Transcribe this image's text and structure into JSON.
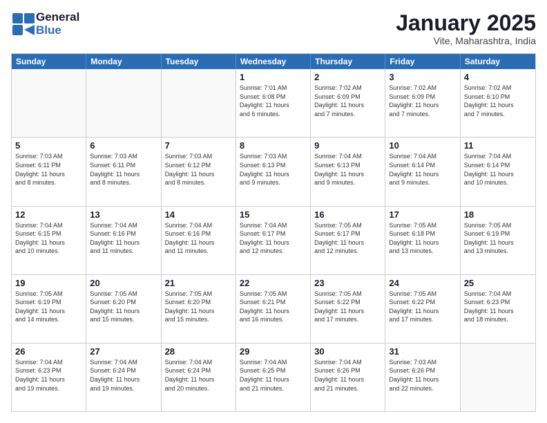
{
  "logo": {
    "line1": "General",
    "line2": "Blue"
  },
  "title": "January 2025",
  "subtitle": "Vite, Maharashtra, India",
  "dayHeaders": [
    "Sunday",
    "Monday",
    "Tuesday",
    "Wednesday",
    "Thursday",
    "Friday",
    "Saturday"
  ],
  "weeks": [
    [
      {
        "num": "",
        "info": ""
      },
      {
        "num": "",
        "info": ""
      },
      {
        "num": "",
        "info": ""
      },
      {
        "num": "1",
        "info": "Sunrise: 7:01 AM\nSunset: 6:08 PM\nDaylight: 11 hours\nand 6 minutes."
      },
      {
        "num": "2",
        "info": "Sunrise: 7:02 AM\nSunset: 6:09 PM\nDaylight: 11 hours\nand 7 minutes."
      },
      {
        "num": "3",
        "info": "Sunrise: 7:02 AM\nSunset: 6:09 PM\nDaylight: 11 hours\nand 7 minutes."
      },
      {
        "num": "4",
        "info": "Sunrise: 7:02 AM\nSunset: 6:10 PM\nDaylight: 11 hours\nand 7 minutes."
      }
    ],
    [
      {
        "num": "5",
        "info": "Sunrise: 7:03 AM\nSunset: 6:11 PM\nDaylight: 11 hours\nand 8 minutes."
      },
      {
        "num": "6",
        "info": "Sunrise: 7:03 AM\nSunset: 6:11 PM\nDaylight: 11 hours\nand 8 minutes."
      },
      {
        "num": "7",
        "info": "Sunrise: 7:03 AM\nSunset: 6:12 PM\nDaylight: 11 hours\nand 8 minutes."
      },
      {
        "num": "8",
        "info": "Sunrise: 7:03 AM\nSunset: 6:13 PM\nDaylight: 11 hours\nand 9 minutes."
      },
      {
        "num": "9",
        "info": "Sunrise: 7:04 AM\nSunset: 6:13 PM\nDaylight: 11 hours\nand 9 minutes."
      },
      {
        "num": "10",
        "info": "Sunrise: 7:04 AM\nSunset: 6:14 PM\nDaylight: 11 hours\nand 9 minutes."
      },
      {
        "num": "11",
        "info": "Sunrise: 7:04 AM\nSunset: 6:14 PM\nDaylight: 11 hours\nand 10 minutes."
      }
    ],
    [
      {
        "num": "12",
        "info": "Sunrise: 7:04 AM\nSunset: 6:15 PM\nDaylight: 11 hours\nand 10 minutes."
      },
      {
        "num": "13",
        "info": "Sunrise: 7:04 AM\nSunset: 6:16 PM\nDaylight: 11 hours\nand 11 minutes."
      },
      {
        "num": "14",
        "info": "Sunrise: 7:04 AM\nSunset: 6:16 PM\nDaylight: 11 hours\nand 11 minutes."
      },
      {
        "num": "15",
        "info": "Sunrise: 7:04 AM\nSunset: 6:17 PM\nDaylight: 11 hours\nand 12 minutes."
      },
      {
        "num": "16",
        "info": "Sunrise: 7:05 AM\nSunset: 6:17 PM\nDaylight: 11 hours\nand 12 minutes."
      },
      {
        "num": "17",
        "info": "Sunrise: 7:05 AM\nSunset: 6:18 PM\nDaylight: 11 hours\nand 13 minutes."
      },
      {
        "num": "18",
        "info": "Sunrise: 7:05 AM\nSunset: 6:19 PM\nDaylight: 11 hours\nand 13 minutes."
      }
    ],
    [
      {
        "num": "19",
        "info": "Sunrise: 7:05 AM\nSunset: 6:19 PM\nDaylight: 11 hours\nand 14 minutes."
      },
      {
        "num": "20",
        "info": "Sunrise: 7:05 AM\nSunset: 6:20 PM\nDaylight: 11 hours\nand 15 minutes."
      },
      {
        "num": "21",
        "info": "Sunrise: 7:05 AM\nSunset: 6:20 PM\nDaylight: 11 hours\nand 15 minutes."
      },
      {
        "num": "22",
        "info": "Sunrise: 7:05 AM\nSunset: 6:21 PM\nDaylight: 11 hours\nand 16 minutes."
      },
      {
        "num": "23",
        "info": "Sunrise: 7:05 AM\nSunset: 6:22 PM\nDaylight: 11 hours\nand 17 minutes."
      },
      {
        "num": "24",
        "info": "Sunrise: 7:05 AM\nSunset: 6:22 PM\nDaylight: 11 hours\nand 17 minutes."
      },
      {
        "num": "25",
        "info": "Sunrise: 7:04 AM\nSunset: 6:23 PM\nDaylight: 11 hours\nand 18 minutes."
      }
    ],
    [
      {
        "num": "26",
        "info": "Sunrise: 7:04 AM\nSunset: 6:23 PM\nDaylight: 11 hours\nand 19 minutes."
      },
      {
        "num": "27",
        "info": "Sunrise: 7:04 AM\nSunset: 6:24 PM\nDaylight: 11 hours\nand 19 minutes."
      },
      {
        "num": "28",
        "info": "Sunrise: 7:04 AM\nSunset: 6:24 PM\nDaylight: 11 hours\nand 20 minutes."
      },
      {
        "num": "29",
        "info": "Sunrise: 7:04 AM\nSunset: 6:25 PM\nDaylight: 11 hours\nand 21 minutes."
      },
      {
        "num": "30",
        "info": "Sunrise: 7:04 AM\nSunset: 6:26 PM\nDaylight: 11 hours\nand 21 minutes."
      },
      {
        "num": "31",
        "info": "Sunrise: 7:03 AM\nSunset: 6:26 PM\nDaylight: 11 hours\nand 22 minutes."
      },
      {
        "num": "",
        "info": ""
      }
    ]
  ]
}
